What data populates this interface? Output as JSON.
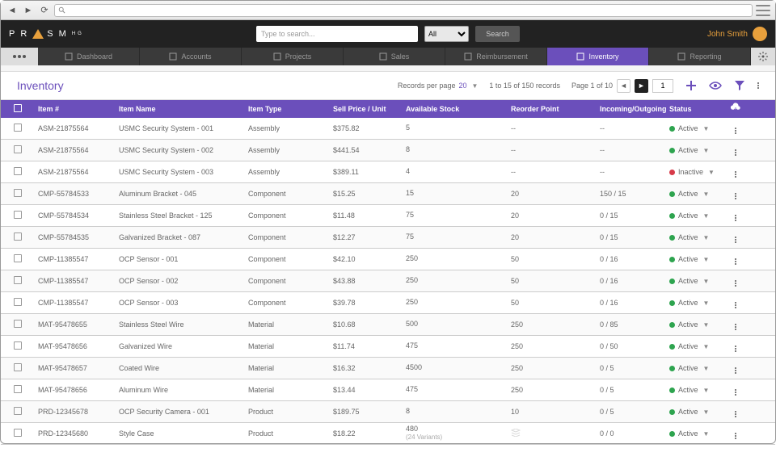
{
  "browser": {
    "url": ""
  },
  "brand": {
    "name": "PR  SM",
    "sup": "HG"
  },
  "search": {
    "placeholder": "Type to search...",
    "filter_all": "All",
    "button": "Search"
  },
  "user": {
    "name": "John Smith"
  },
  "nav": [
    {
      "label": "Dashboard"
    },
    {
      "label": "Accounts"
    },
    {
      "label": "Projects"
    },
    {
      "label": "Sales"
    },
    {
      "label": "Reimbursement"
    },
    {
      "label": "Inventory",
      "active": true
    },
    {
      "label": "Reporting"
    }
  ],
  "page": {
    "title": "Inventory"
  },
  "toolbar": {
    "records_per_page_label": "Records per page",
    "records_per_page_value": "20",
    "range": "1 to 15 of 150 records",
    "page_label": "Page 1 of 10",
    "page_input": "1"
  },
  "columns": {
    "item": "Item #",
    "name": "Item Name",
    "type": "Item Type",
    "price": "Sell Price / Unit",
    "stock": "Available Stock",
    "reorder": "Reorder Point",
    "io": "Incoming/Outgoing",
    "status": "Status"
  },
  "rows": [
    {
      "item": "ASM-21875564",
      "name": "USMC Security System - 001",
      "type": "Assembly",
      "price": "$375.82",
      "stock": "5",
      "reorder": "--",
      "io": "--",
      "status": "Active",
      "dot": "green"
    },
    {
      "item": "ASM-21875564",
      "name": "USMC Security System - 002",
      "type": "Assembly",
      "price": "$441.54",
      "stock": "8",
      "reorder": "--",
      "io": "--",
      "status": "Active",
      "dot": "green"
    },
    {
      "item": "ASM-21875564",
      "name": "USMC Security System - 003",
      "type": "Assembly",
      "price": "$389.11",
      "stock": "4",
      "reorder": "--",
      "io": "--",
      "status": "Inactive",
      "dot": "red"
    },
    {
      "item": "CMP-55784533",
      "name": "Aluminum Bracket - 045",
      "type": "Component",
      "price": "$15.25",
      "stock": "15",
      "reorder": "20",
      "io": "150 / 15",
      "status": "Active",
      "dot": "green"
    },
    {
      "item": "CMP-55784534",
      "name": "Stainless Steel Bracket - 125",
      "type": "Component",
      "price": "$11.48",
      "stock": "75",
      "reorder": "20",
      "io": "0 / 15",
      "status": "Active",
      "dot": "green"
    },
    {
      "item": "CMP-55784535",
      "name": "Galvanized Bracket - 087",
      "type": "Component",
      "price": "$12.27",
      "stock": "75",
      "reorder": "20",
      "io": "0 / 15",
      "status": "Active",
      "dot": "green"
    },
    {
      "item": "CMP-11385547",
      "name": "OCP Sensor - 001",
      "type": "Component",
      "price": "$42.10",
      "stock": "250",
      "reorder": "50",
      "io": "0 / 16",
      "status": "Active",
      "dot": "green"
    },
    {
      "item": "CMP-11385547",
      "name": "OCP Sensor - 002",
      "type": "Component",
      "price": "$43.88",
      "stock": "250",
      "reorder": "50",
      "io": "0 / 16",
      "status": "Active",
      "dot": "green"
    },
    {
      "item": "CMP-11385547",
      "name": "OCP Sensor - 003",
      "type": "Component",
      "price": "$39.78",
      "stock": "250",
      "reorder": "50",
      "io": "0 / 16",
      "status": "Active",
      "dot": "green"
    },
    {
      "item": "MAT-95478655",
      "name": "Stainless Steel Wire",
      "type": "Material",
      "price": "$10.68",
      "stock": "500",
      "reorder": "250",
      "io": "0 / 85",
      "status": "Active",
      "dot": "green"
    },
    {
      "item": "MAT-95478656",
      "name": "Galvanized Wire",
      "type": "Material",
      "price": "$11.74",
      "stock": "475",
      "reorder": "250",
      "io": "0 / 50",
      "status": "Active",
      "dot": "green"
    },
    {
      "item": "MAT-95478657",
      "name": "Coated Wire",
      "type": "Material",
      "price": "$16.32",
      "stock": "4500",
      "reorder": "250",
      "io": "0 / 5",
      "status": "Active",
      "dot": "green"
    },
    {
      "item": "MAT-95478656",
      "name": "Aluminum Wire",
      "type": "Material",
      "price": "$13.44",
      "stock": "475",
      "reorder": "250",
      "io": "0 / 5",
      "status": "Active",
      "dot": "green"
    },
    {
      "item": "PRD-12345678",
      "name": "OCP Security Camera - 001",
      "type": "Product",
      "price": "$189.75",
      "stock": "8",
      "reorder": "10",
      "io": "0 / 5",
      "status": "Active",
      "dot": "green"
    },
    {
      "item": "PRD-12345680",
      "name": "Style Case",
      "type": "Product",
      "price": "$18.22",
      "stock": "480",
      "stock_sub": "(24 Variants)",
      "reorder": "icon",
      "io": "0 / 0",
      "status": "Active",
      "dot": "green"
    }
  ]
}
